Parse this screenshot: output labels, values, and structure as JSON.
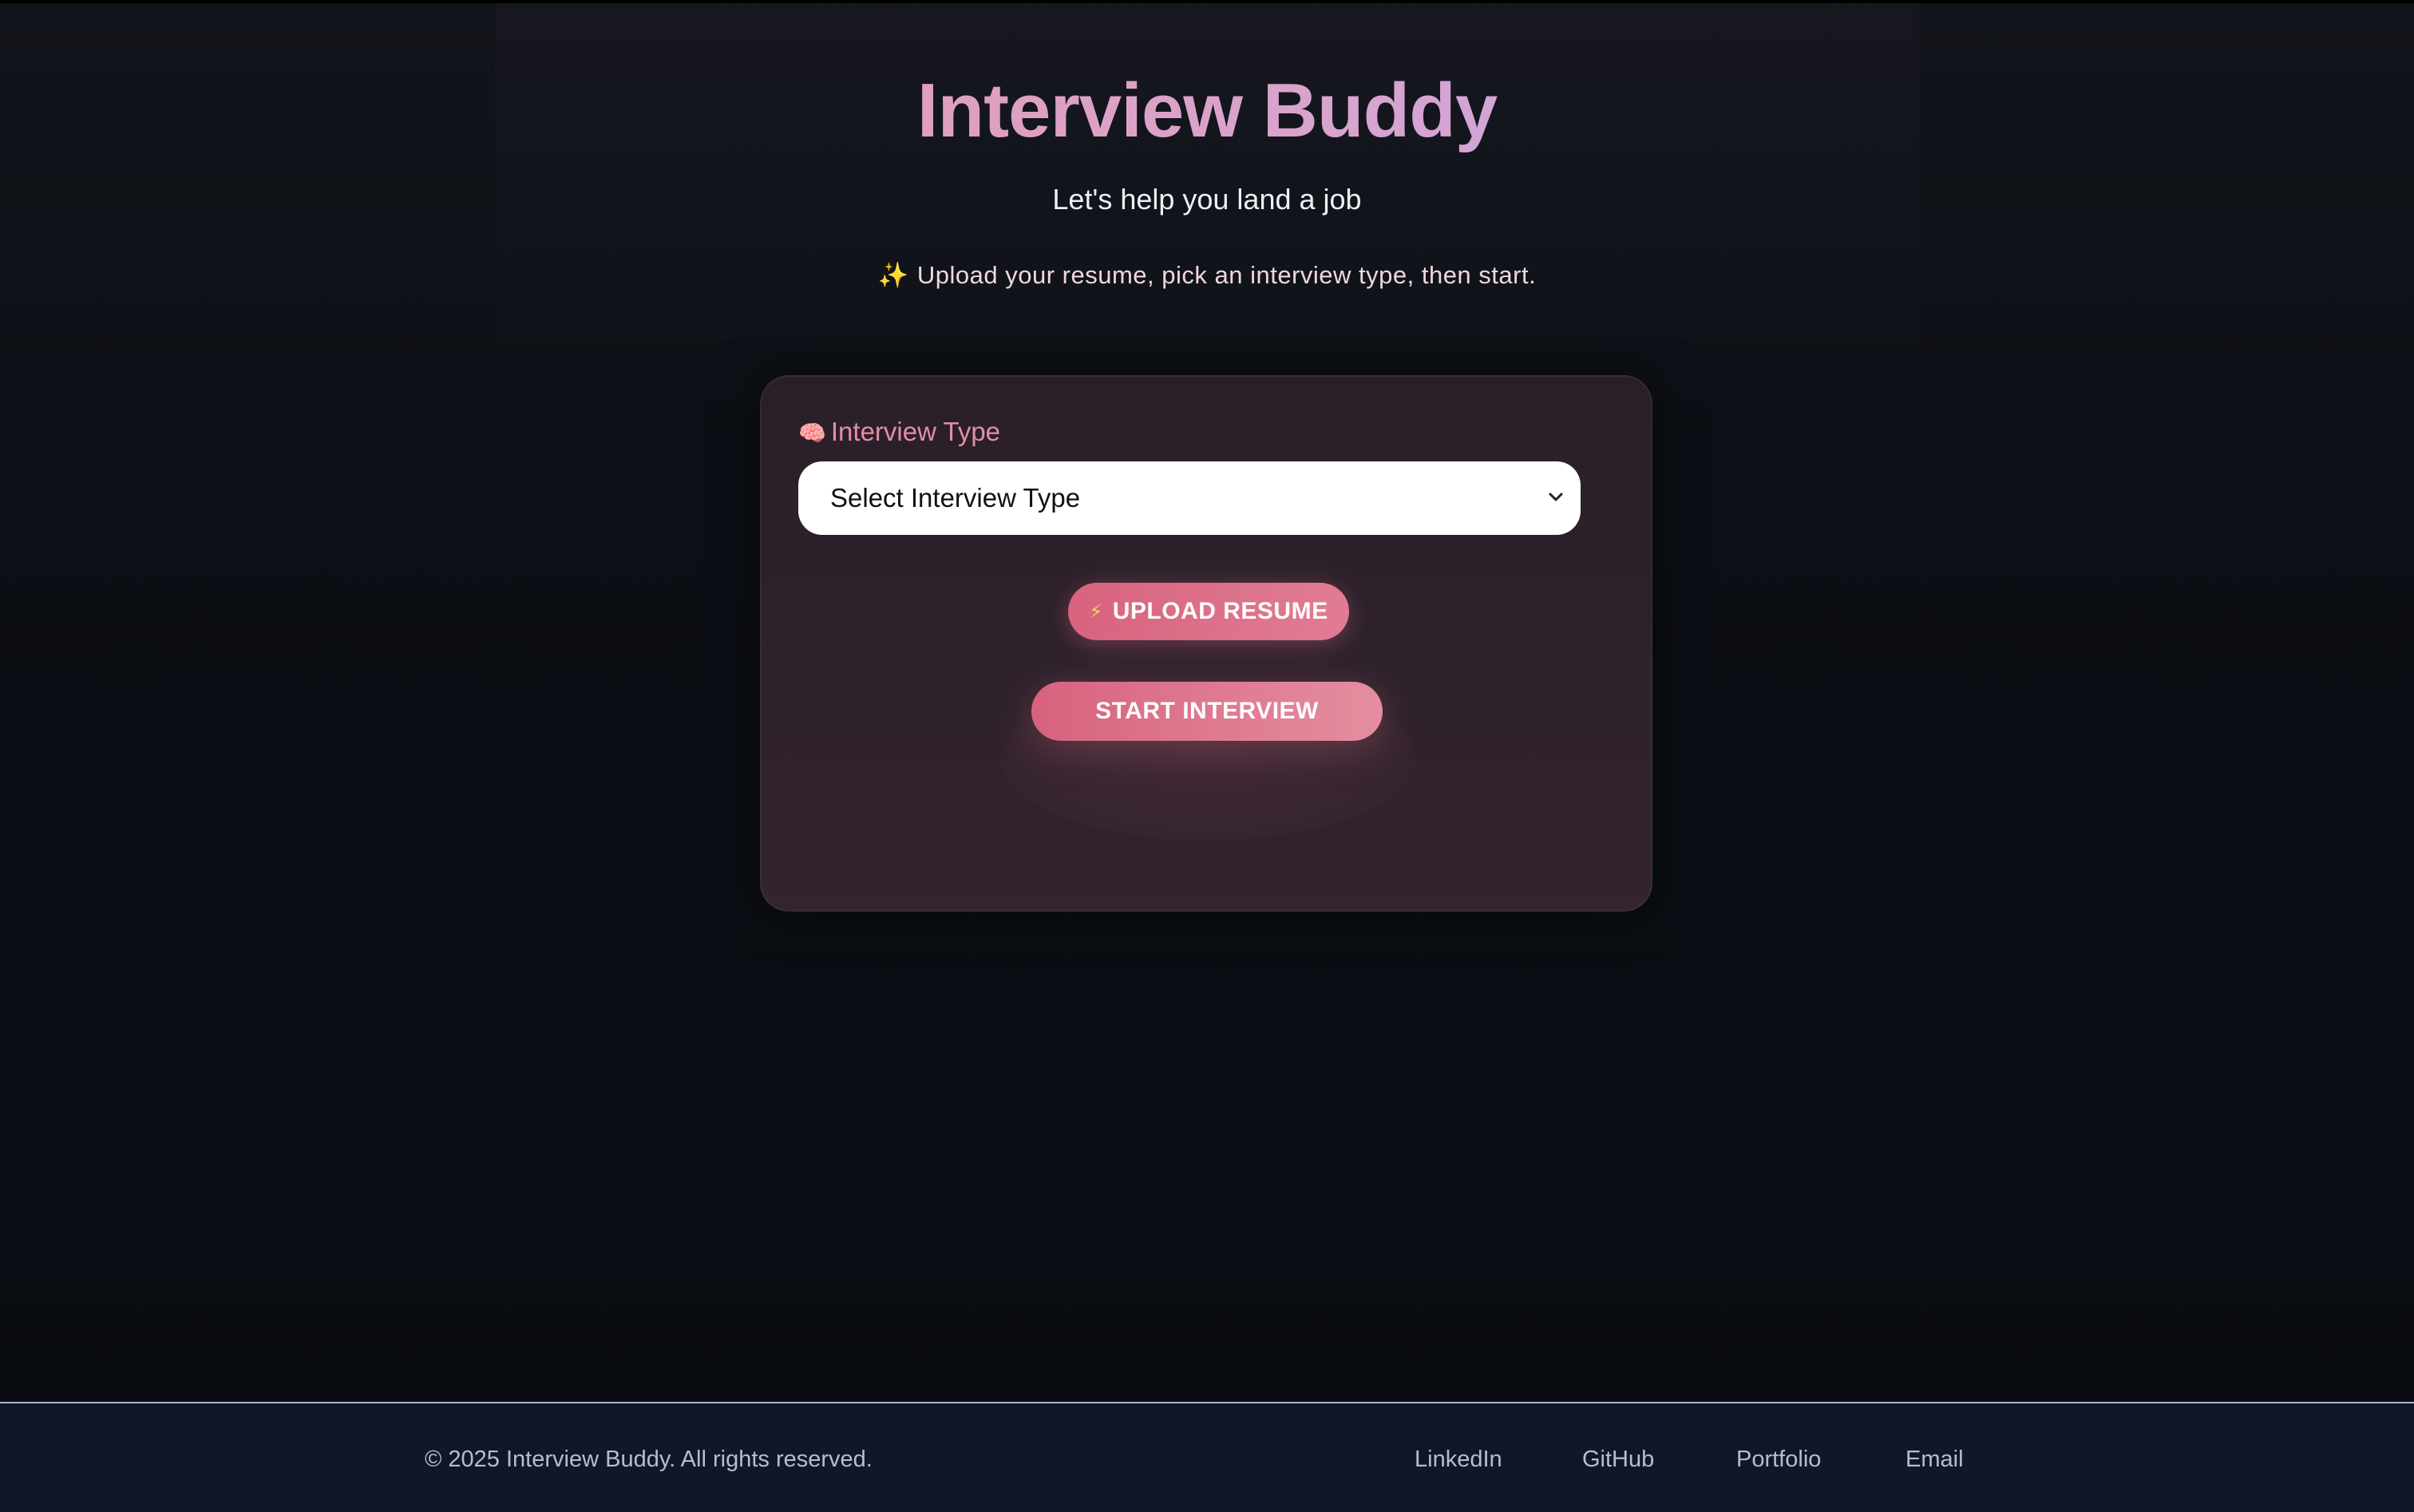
{
  "header": {
    "title": "Interview Buddy",
    "subtitle": "Let's help you land a job",
    "hint_icon": "sparkles-icon",
    "hint_emoji": "✨",
    "hint": "Upload your resume, pick an interview type, then start."
  },
  "form": {
    "interview_type_icon": "brain-icon",
    "interview_type_emoji": "🧠",
    "interview_type_label": "Interview Type",
    "select_value": "Select Interview Type",
    "upload_icon": "lightning-icon",
    "upload_emoji": "⚡",
    "upload_label": "UPLOAD RESUME",
    "start_label": "START INTERVIEW"
  },
  "footer": {
    "copyright": "© 2025 Interview Buddy. All rights reserved.",
    "links": [
      "LinkedIn",
      "GitHub",
      "Portfolio",
      "Email"
    ]
  },
  "colors": {
    "background": "#0b0e14",
    "card": "#2e222c",
    "accent": "#e07c93",
    "title_gradient_start": "#e89aae",
    "title_gradient_end": "#c5a8e6",
    "footer": "#0f1729"
  }
}
